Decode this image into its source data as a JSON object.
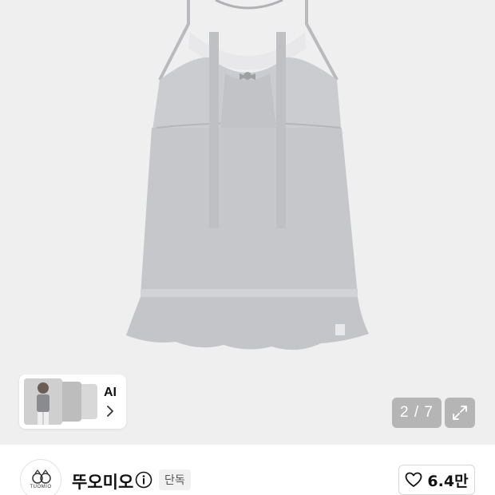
{
  "gallery": {
    "current_page": "2",
    "total_pages": "7",
    "counter_text": "2 / 7"
  },
  "ai_card": {
    "label": "AI"
  },
  "seller": {
    "logo_text": "TUOMIO",
    "name": "뚜오미오",
    "badge": "단독"
  },
  "like": {
    "count": "6.4만"
  },
  "icons": {
    "info": "info-icon",
    "expand": "expand-icon",
    "chevron": "chevron-right-icon",
    "heart": "heart-icon"
  },
  "colors": {
    "gallery_bg": "#efefef",
    "dress": "#c8c9cc",
    "overlay": "#aaaaaa"
  }
}
